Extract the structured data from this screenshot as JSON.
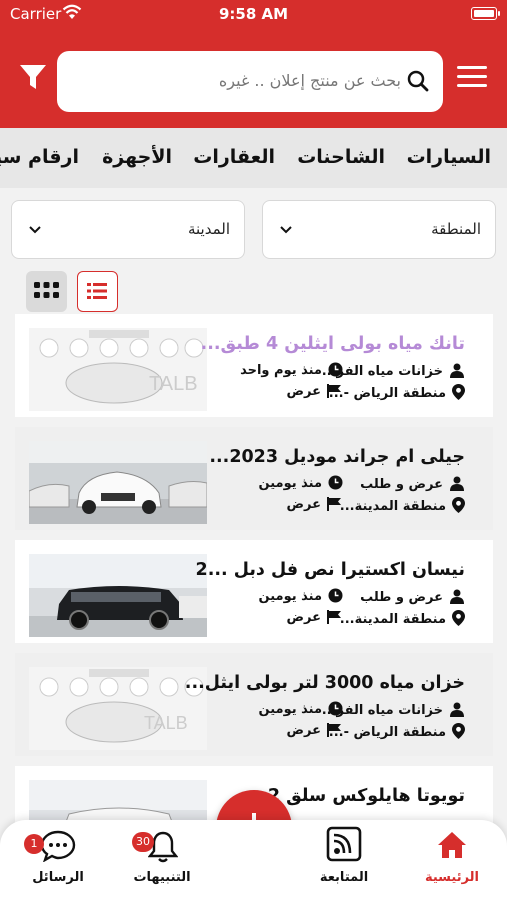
{
  "status_bar": {
    "carrier": "Carrier",
    "time": "9:58 AM"
  },
  "search": {
    "placeholder": "بحث عن منتج إعلان .. غيره"
  },
  "categories": [
    "السيارات",
    "الشاحنات",
    "العقارات",
    "الأجهزة",
    "ارقام سيا"
  ],
  "filters": {
    "region_label": "المنطقة",
    "city_label": "المدينة"
  },
  "listings": [
    {
      "title": "تانك مياه بولى ايثلين 4 طبق...",
      "category": "خزانات مياه الفر...",
      "time": "منذ يوم واحد",
      "region": "منطقة الرياض -...",
      "type": "عرض",
      "title_color": "#b58ad6",
      "image": "water-tank-image"
    },
    {
      "title": "جيلى ام جراند موديل 2023...",
      "category": "عرض و طلب",
      "time": "منذ يومين",
      "region": "منطقة المدينة...",
      "type": "عرض",
      "title_color": "#111111",
      "image": "white-car-image"
    },
    {
      "title": "نيسان اكستيرا نص فل دبل ...2",
      "category": "عرض و طلب",
      "time": "منذ يومين",
      "region": "منطقة المدينة...",
      "type": "عرض",
      "title_color": "#111111",
      "image": "black-suv-image"
    },
    {
      "title": "خزان مياه 3000 لتر بولى ايثل...",
      "category": "خزانات مياه الفر...",
      "time": "منذ يومين",
      "region": "منطقة الرياض -...",
      "type": "عرض",
      "title_color": "#111111",
      "image": "water-tank-image"
    },
    {
      "title": "تويوتا هايلوكس سلق 2 ...",
      "category": "",
      "time": "",
      "region": "",
      "type": "",
      "title_color": "#111111",
      "image": "pickup-truck-image"
    }
  ],
  "bottom_nav": {
    "home": "الرئيسية",
    "following": "المتابعة",
    "notifications": "التنبيهات",
    "notifications_badge": "30",
    "messages": "الرسائل",
    "messages_badge": "1"
  },
  "colors": {
    "brand": "#d62e2c",
    "accent_title": "#b58ad6"
  },
  "icons": [
    "filter-icon",
    "menu-icon",
    "search-icon",
    "chevron-down-icon",
    "grid-view-icon",
    "list-view-icon",
    "person-icon",
    "clock-icon",
    "location-icon",
    "flag-icon",
    "home-icon",
    "rss-icon",
    "plus-icon",
    "bell-icon",
    "chat-icon"
  ]
}
